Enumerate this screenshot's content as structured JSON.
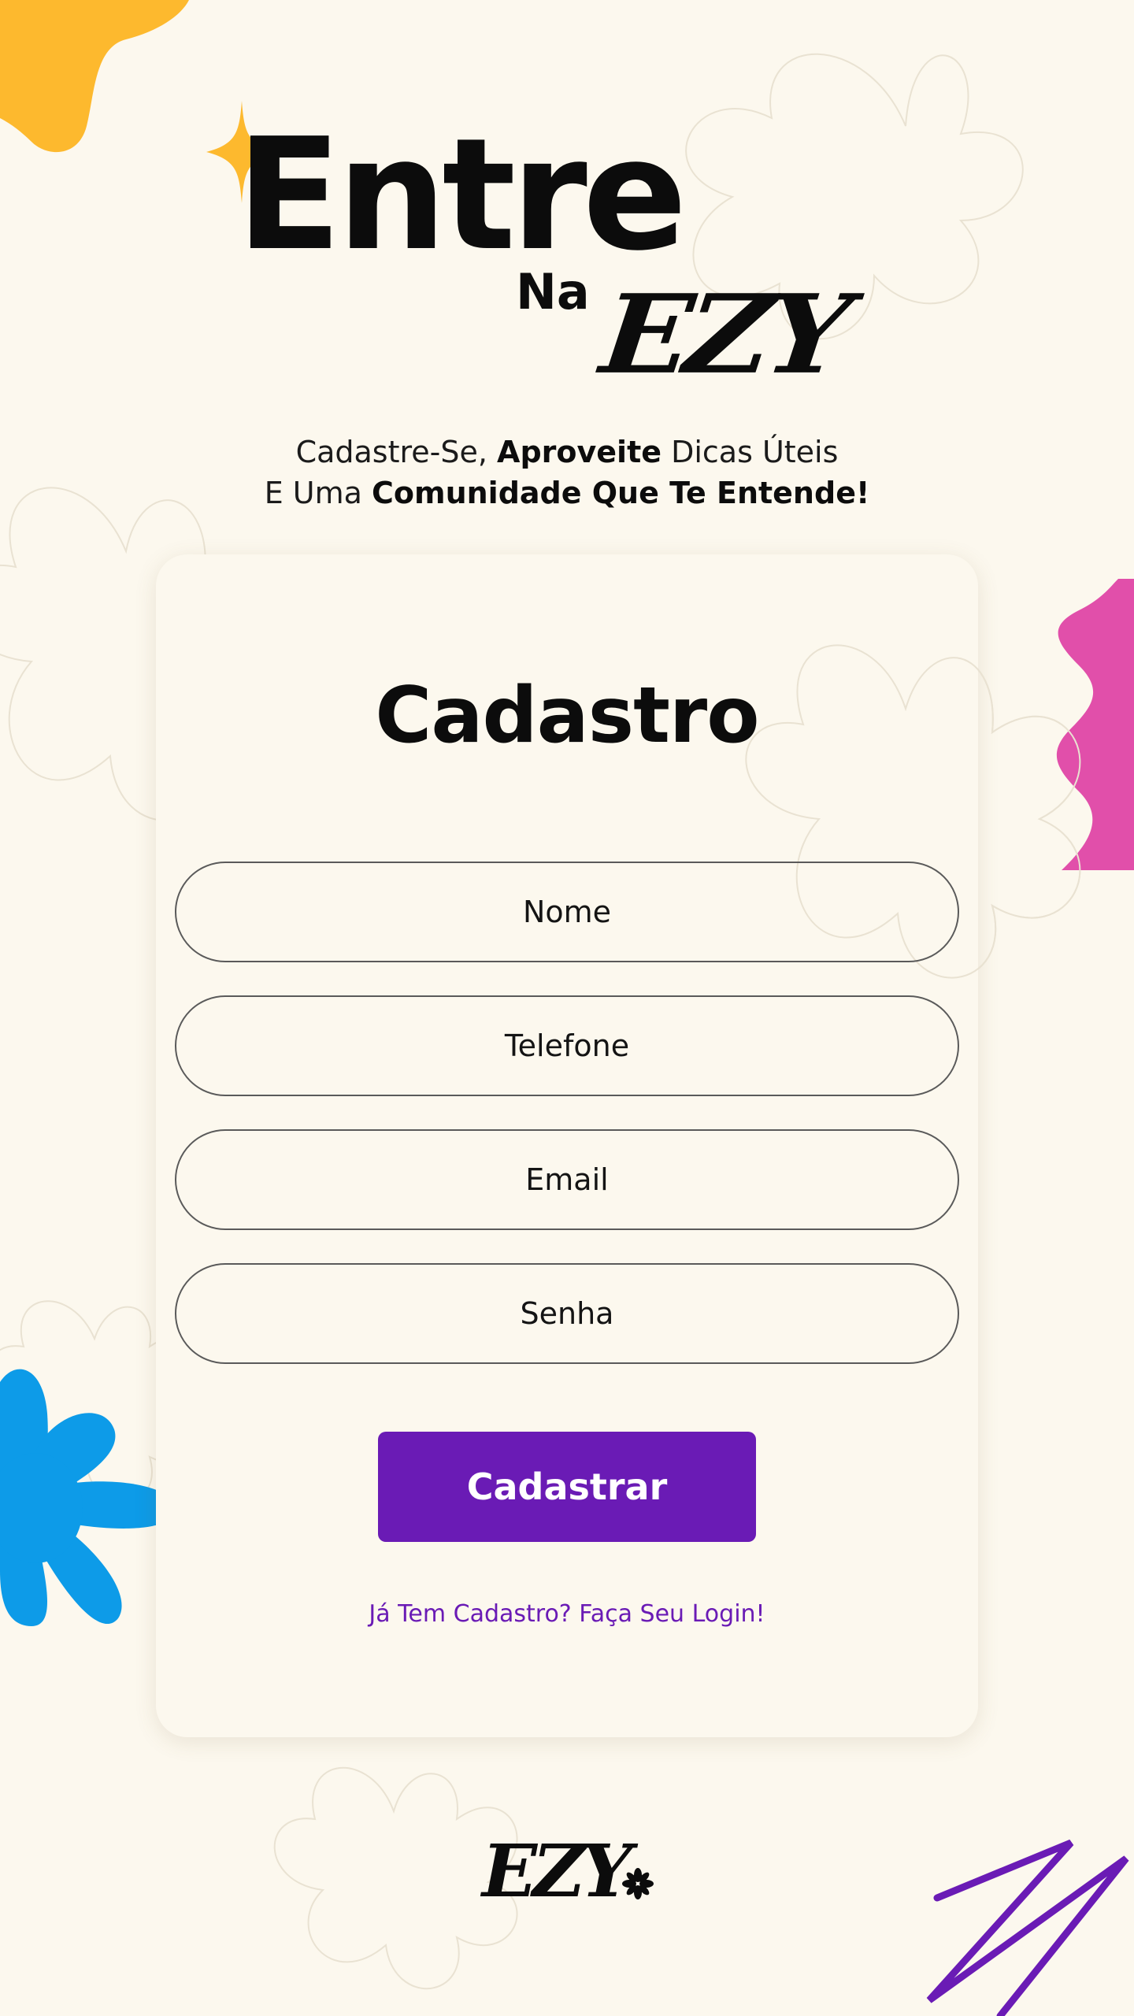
{
  "hero": {
    "line1": "Entre",
    "line2": "Na",
    "brand": "EZY",
    "tagline": {
      "part1": "Cadastre-Se, ",
      "bold1": "Aproveite",
      "part2": " Dicas Úteis",
      "part3": "E Uma ",
      "bold2": "Comunidade Que Te Entende!"
    }
  },
  "form": {
    "title": "Cadastro",
    "fields": [
      {
        "placeholder": "Nome"
      },
      {
        "placeholder": "Telefone"
      },
      {
        "placeholder": "Email"
      },
      {
        "placeholder": "Senha"
      }
    ],
    "submit_label": "Cadastrar",
    "login_link": "Já Tem Cadastro? Faça Seu Login!"
  },
  "footer": {
    "brand": "EZY",
    "star_icon": "asterisk-flower-icon"
  },
  "colors": {
    "background": "#FCF8EE",
    "primary": "#6A1BB5",
    "yellow": "#FDB92E",
    "pink": "#E14FAA",
    "blue": "#0D9BE8",
    "purple_zigzag": "#6A1BB5"
  }
}
